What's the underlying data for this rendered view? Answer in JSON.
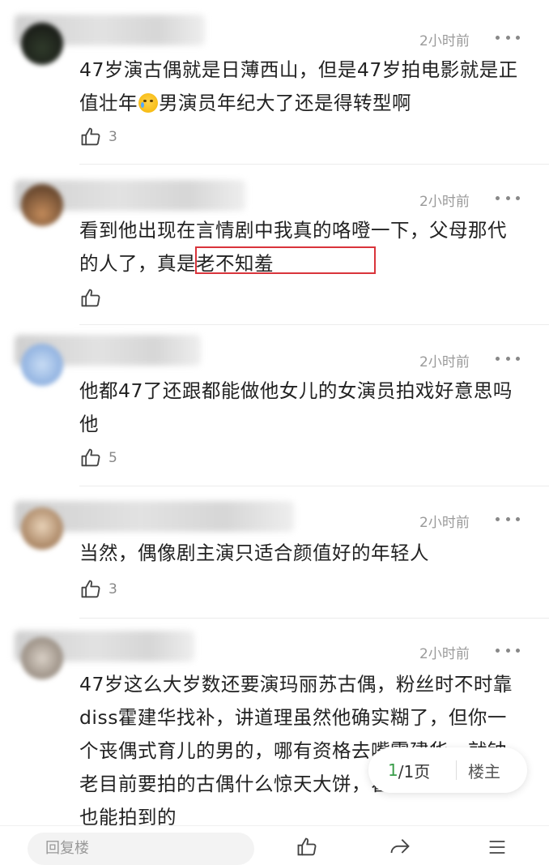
{
  "comments": [
    {
      "time": "2小时前",
      "text_before_emoji": "47岁演古偶就是日薄西山，但是47岁拍电影就是正值壮年",
      "text_after_emoji": "男演员年纪大了还是得转型啊",
      "emoji": "crying-face",
      "likes": "3"
    },
    {
      "time": "2小时前",
      "text": "看到他出现在言情剧中我真的咯噔一下，父母那代的人了，真是老不知羞",
      "highlight": "真是老不知羞",
      "likes": ""
    },
    {
      "time": "2小时前",
      "text": "他都47了还跟都能做他女儿的女演员拍戏好意思吗他",
      "likes": "5"
    },
    {
      "time": "2小时前",
      "text": "当然，偶像剧主演只适合颜值好的年轻人",
      "likes": "3"
    },
    {
      "time": "2小时前",
      "text": "47岁这么大岁数还要演玛丽苏古偶，粉丝时不时靠diss霍建华找补，讲道理虽然他确实糊了，但你一个丧偶式育儿的男的，哪有资格去嘴霍建华，就钟老目前要拍的古偶什么惊天大饼，霍建华脸皮厚点也能拍到的",
      "likes": ""
    }
  ],
  "pager": {
    "current": "1",
    "total": "/1页",
    "host_label": "楼主"
  },
  "reply_placeholder": "回复楼",
  "colors": {
    "highlight_border": "#d9343b",
    "pager_current": "#3a9d4a"
  }
}
